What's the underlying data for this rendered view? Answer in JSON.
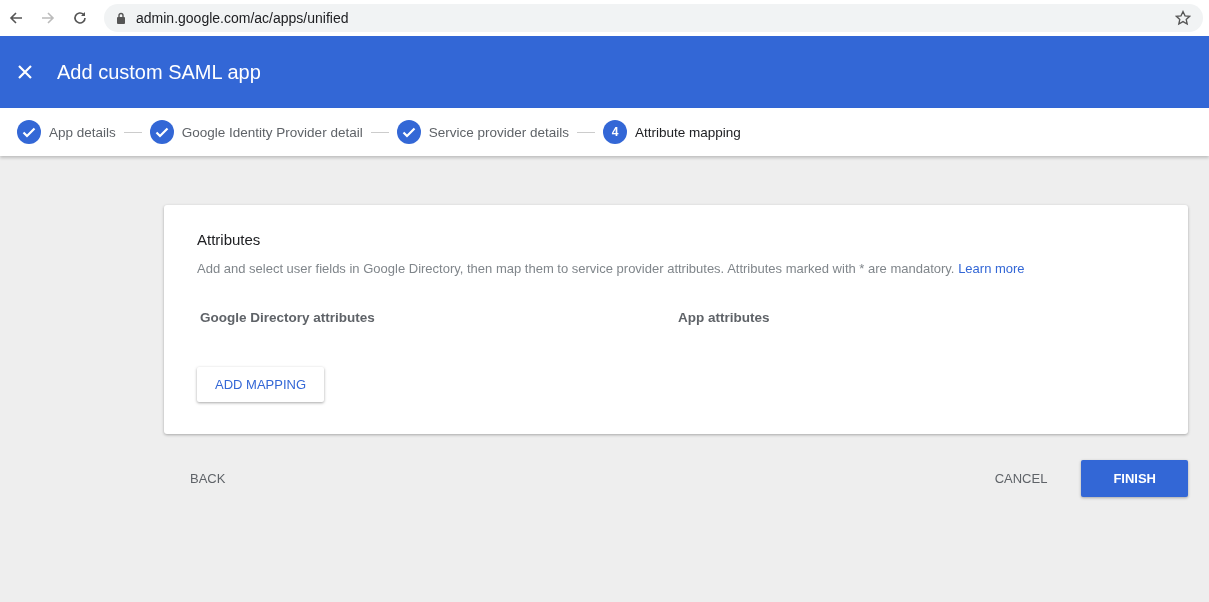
{
  "browser": {
    "url": "admin.google.com/ac/apps/unified"
  },
  "header": {
    "title": "Add custom SAML app"
  },
  "steps": [
    {
      "label": "App details",
      "done": true,
      "selected": false
    },
    {
      "label": "Google Identity Provider detail",
      "done": true,
      "selected": false
    },
    {
      "label": "Service provider details",
      "done": true,
      "selected": false
    },
    {
      "label": "Attribute mapping",
      "number": "4",
      "done": false,
      "selected": true
    }
  ],
  "card": {
    "title": "Attributes",
    "description": "Add and select user fields in Google Directory, then map them to service provider attributes. Attributes marked with * are mandatory.",
    "link": "Learn more",
    "columns": [
      "Google Directory attributes",
      "App attributes"
    ],
    "add_button": "ADD MAPPING"
  },
  "actions": {
    "back": "BACK",
    "cancel": "CANCEL",
    "finish": "FINISH"
  }
}
